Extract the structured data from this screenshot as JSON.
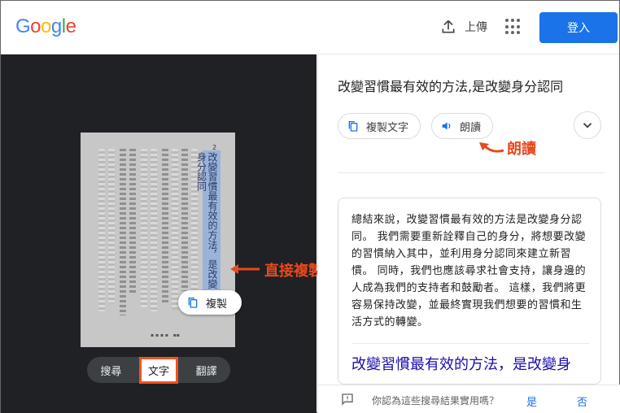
{
  "header": {
    "logo_letters": [
      {
        "ch": "G",
        "color": "#4285F4"
      },
      {
        "ch": "o",
        "color": "#EA4335"
      },
      {
        "ch": "o",
        "color": "#FBBC05"
      },
      {
        "ch": "g",
        "color": "#4285F4"
      },
      {
        "ch": "l",
        "color": "#34A853"
      },
      {
        "ch": "e",
        "color": "#EA4335"
      }
    ],
    "upload_label": "上傳",
    "signin_label": "登入"
  },
  "lens": {
    "page_number": "2",
    "highlighted_text": "改變習慣最有效的方法，是改變身分認同",
    "copy_chip_label": "複製",
    "modes": [
      "搜尋",
      "文字",
      "翻譯"
    ],
    "active_mode": "文字"
  },
  "annotations": {
    "copy_direct": "直接複製文字",
    "read_aloud": "朗讀"
  },
  "result": {
    "title": "改變習慣最有效的方法,是改變身分認同",
    "copy_text_label": "複製文字",
    "listen_label": "朗讀",
    "card_body": "總結來說，改變習慣最有效的方法是改變身分認同。 我們需要重新詮釋自己的身分，將想要改變的習慣納入其中，並利用身分認同來建立新習慣。 同時，我們也應該尋求社會支持，讓身邊的人成為我們的支持者和鼓勵者。 這樣，我們將更容易保持改變，並最終實現我們想要的習慣和生活方式的轉變。",
    "card_link": "改變習慣最有效的方法，是改變身",
    "feedback_question": "你認為這些搜尋結果實用嗎？",
    "yes": "是",
    "no": "否"
  },
  "colors": {
    "accent": "#1a73e8",
    "annotation": "#e8491d",
    "dark_pane": "#202124"
  }
}
